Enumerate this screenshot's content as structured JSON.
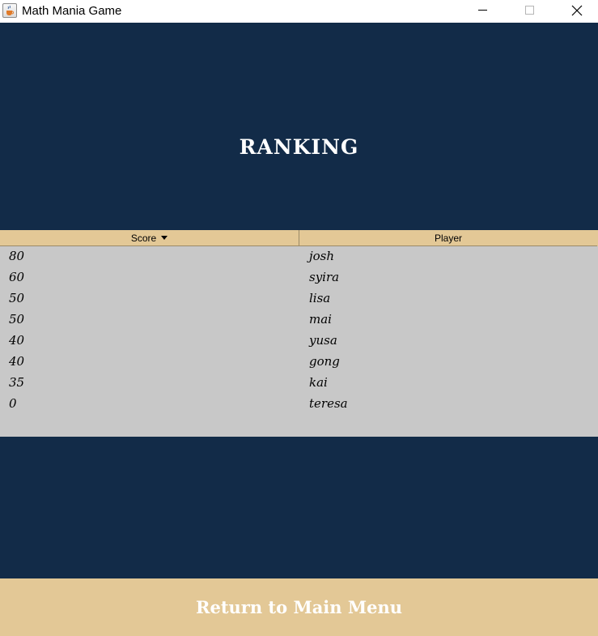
{
  "window": {
    "title": "Math Mania Game",
    "icon": "java-cup-icon"
  },
  "colors": {
    "navy": "#122b48",
    "tan": "#e3c896",
    "table_bg": "#c8c8c8",
    "white": "#ffffff"
  },
  "heading": "RANKING",
  "table": {
    "columns": [
      "Score",
      "Player"
    ],
    "sorted_by": "Score",
    "rows": [
      {
        "score": "80",
        "player": "josh"
      },
      {
        "score": "60",
        "player": "syira"
      },
      {
        "score": "50",
        "player": "lisa"
      },
      {
        "score": "50",
        "player": "mai"
      },
      {
        "score": "40",
        "player": "yusa"
      },
      {
        "score": "40",
        "player": "gong"
      },
      {
        "score": "35",
        "player": "kai"
      },
      {
        "score": "0",
        "player": "teresa"
      }
    ]
  },
  "return_button": {
    "label": "Return to Main Menu"
  }
}
